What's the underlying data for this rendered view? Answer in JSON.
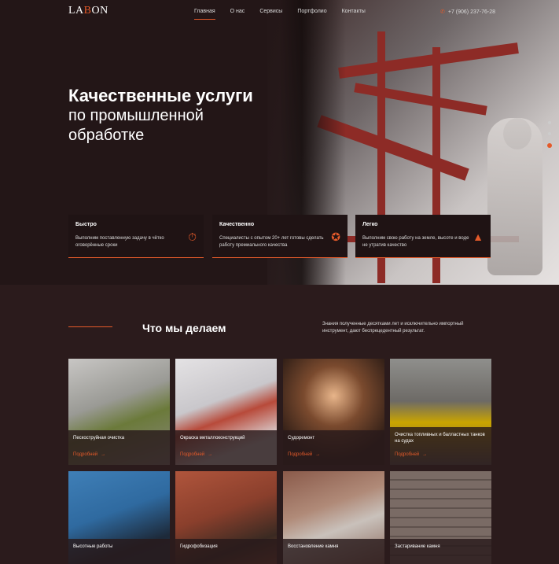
{
  "header": {
    "logo_left": "LA",
    "logo_mid": "B",
    "logo_right": "ON",
    "nav": [
      "Главная",
      "О нас",
      "Сервисы",
      "Портфолио",
      "Контакты"
    ],
    "phone": "+7 (906) 237-76-28"
  },
  "hero": {
    "title": "Качественные услуги",
    "subtitle": "по промышленной обработке",
    "slides": 3,
    "active_slide": 3
  },
  "features": [
    {
      "title": "Быстро",
      "desc": "Выполним поставленную задачу в чётко оговорённые сроки",
      "icon": "stopwatch-icon"
    },
    {
      "title": "Качественно",
      "desc": "Специалисты с опытом 20+ лет готовы сделать работу премиального качества",
      "icon": "award-icon"
    },
    {
      "title": "Легко",
      "desc": "Выполним свою работу на земле, высоте и воде не утратив качество",
      "icon": "mountain-icon"
    }
  ],
  "section": {
    "title": "Что мы делаем",
    "desc": "Знания полученные десятками лет и исключительно импортный инструмент, дают беспрецедентный результат."
  },
  "services": [
    {
      "name": "Пескоструйная очистка",
      "more": "Подробней"
    },
    {
      "name": "Окраска металлоконструкций",
      "more": "Подробней"
    },
    {
      "name": "Судоремонт",
      "more": "Подробней"
    },
    {
      "name": "Очистка топливных и балластных танков на судах",
      "more": "Подробней"
    },
    {
      "name": "Высотные работы"
    },
    {
      "name": "Гидрофобизация"
    },
    {
      "name": "Восстановление камня"
    },
    {
      "name": "Застаривание камня"
    }
  ],
  "colors": {
    "accent": "#e45a2a",
    "background": "#2b1b1c"
  }
}
